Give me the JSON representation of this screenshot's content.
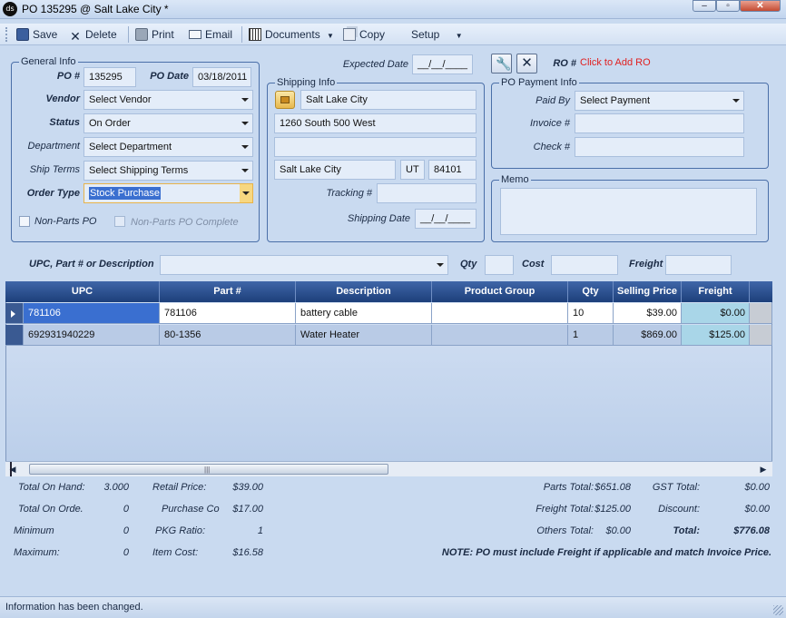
{
  "window": {
    "title": "PO 135295 @ Salt Lake City *",
    "app_icon_text": "ds"
  },
  "toolbar": {
    "save": "Save",
    "delete": "Delete",
    "print": "Print",
    "email": "Email",
    "documents": "Documents",
    "copy": "Copy",
    "setup": "Setup"
  },
  "general": {
    "legend": "General Info",
    "po_label": "PO #",
    "po_value": "135295",
    "po_date_label": "PO Date",
    "po_date_value": "03/18/2011",
    "vendor_label": "Vendor",
    "vendor_value": "Select Vendor",
    "status_label": "Status",
    "status_value": "On Order",
    "department_label": "Department",
    "department_value": "Select Department",
    "ship_terms_label": "Ship Terms",
    "ship_terms_value": "Select Shipping Terms",
    "order_type_label": "Order Type",
    "order_type_value": "Stock Purchase",
    "non_parts_label": "Non-Parts PO",
    "non_parts_complete_label": "Non-Parts PO Complete"
  },
  "top": {
    "expected_date_label": "Expected Date",
    "expected_date_value": "__/__/____",
    "ro_label": "RO #",
    "ro_link": "Click to Add RO"
  },
  "shipping": {
    "legend": "Shipping Info",
    "name": "Salt Lake City",
    "address1": "1260 South 500 West",
    "address2": "",
    "city": "Salt Lake City",
    "state": "UT",
    "zip": "84101",
    "tracking_label": "Tracking #",
    "tracking_value": "",
    "shipping_date_label": "Shipping Date",
    "shipping_date_value": "__/__/____"
  },
  "payment": {
    "legend": "PO Payment Info",
    "paid_by_label": "Paid By",
    "paid_by_value": "Select Payment",
    "invoice_label": "Invoice #",
    "invoice_value": "",
    "check_label": "Check #",
    "check_value": ""
  },
  "memo": {
    "legend": "Memo",
    "value": ""
  },
  "search": {
    "label": "UPC, Part # or Description",
    "value": "",
    "qty_label": "Qty",
    "cost_label": "Cost",
    "freight_label": "Freight"
  },
  "grid": {
    "columns": [
      "UPC",
      "Part #",
      "Description",
      "Product Group",
      "Qty",
      "Selling Price",
      "Freight"
    ],
    "rows": [
      [
        "781106",
        "781106",
        "battery cable",
        "",
        "10",
        "$39.00",
        "$0.00"
      ],
      [
        "692931940229",
        "80-1356",
        "Water Heater",
        "",
        "1",
        "$869.00",
        "$125.00"
      ]
    ]
  },
  "summary": {
    "total_on_hand_label": "Total On Hand:",
    "total_on_hand": "3.000",
    "total_on_order_label": "Total On Orde.",
    "total_on_order": "0",
    "minimum_label": "Minimum",
    "minimum": "0",
    "maximum_label": "Maximum:",
    "maximum": "0",
    "retail_price_label": "Retail Price:",
    "retail_price": "$39.00",
    "purchase_cost_label": "Purchase Co",
    "purchase_cost": "$17.00",
    "pkg_ratio_label": "PKG Ratio:",
    "pkg_ratio": "1",
    "item_cost_label": "Item Cost:",
    "item_cost": "$16.58",
    "parts_total_label": "Parts Total:",
    "parts_total": "$651.08",
    "freight_total_label": "Freight Total:",
    "freight_total": "$125.00",
    "others_total_label": "Others Total:",
    "others_total": "$0.00",
    "gst_total_label": "GST Total:",
    "gst_total": "$0.00",
    "discount_label": "Discount:",
    "discount": "$0.00",
    "total_label": "Total:",
    "total": "$776.08",
    "note": "NOTE: PO must include Freight if applicable and match Invoice Price."
  },
  "status": {
    "message": "Information has been changed."
  },
  "colors": {
    "link_red": "#e02020",
    "selected_blue": "#3a6fd0",
    "header_blue": "#1d3f7a"
  }
}
